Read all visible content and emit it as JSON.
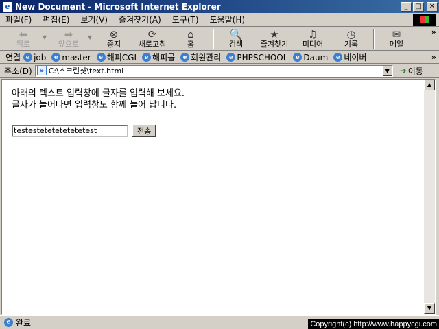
{
  "window": {
    "title": "New Document - Microsoft Internet Explorer"
  },
  "menu": [
    "파일(F)",
    "편집(E)",
    "보기(V)",
    "즐겨찾기(A)",
    "도구(T)",
    "도움말(H)"
  ],
  "toolbar": {
    "back": "뒤로",
    "forward": "앞으로",
    "stop": "중지",
    "refresh": "새로고침",
    "home": "홈",
    "search": "검색",
    "favorites": "즐겨찾기",
    "media": "미디어",
    "history": "기록",
    "mail": "메일"
  },
  "links": {
    "label": "연결",
    "items": [
      "job",
      "master",
      "해피CGI",
      "해피몰",
      "회원관리",
      "PHPSCHOOL",
      "Daum",
      "네이버"
    ]
  },
  "address": {
    "label": "주소(D)",
    "value": "C:\\스크린샷\\text.html",
    "go": "이동"
  },
  "page": {
    "line1": "아래의 텍스트 입력창에 글자를 입력해 보세요.",
    "line2": "글자가 늘어나면 입력창도 함께 늘어 납니다.",
    "input_value": "testestetetetetetetest",
    "submit_label": "전송"
  },
  "status": {
    "text": "완료"
  },
  "watermark": {
    "text": "Copyright(c) http://www.happycgi.com"
  }
}
